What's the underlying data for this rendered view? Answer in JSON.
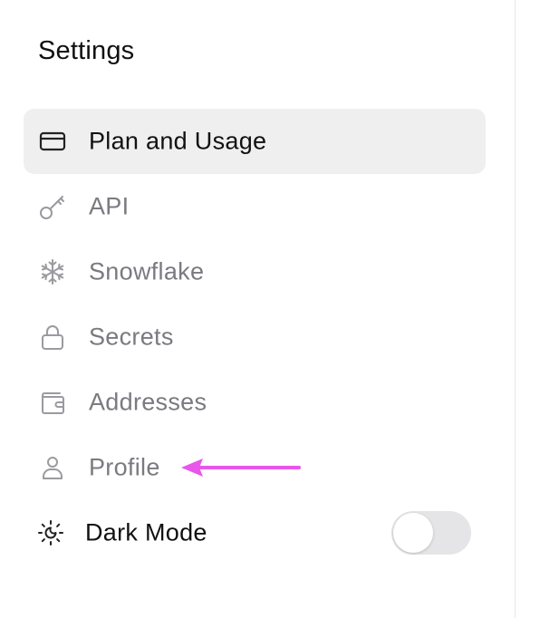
{
  "settings": {
    "title": "Settings"
  },
  "nav": {
    "items": [
      {
        "label": "Plan and Usage",
        "icon": "credit-card-icon",
        "active": true
      },
      {
        "label": "API",
        "icon": "key-icon",
        "active": false
      },
      {
        "label": "Snowflake",
        "icon": "snowflake-icon",
        "active": false
      },
      {
        "label": "Secrets",
        "icon": "lock-icon",
        "active": false
      },
      {
        "label": "Addresses",
        "icon": "wallet-icon",
        "active": false
      },
      {
        "label": "Profile",
        "icon": "user-icon",
        "active": false
      }
    ]
  },
  "dark_mode": {
    "label": "Dark Mode",
    "icon": "sun-moon-icon",
    "enabled": false
  },
  "annotation": {
    "arrow_color": "#e956e9",
    "points_to": "Profile"
  },
  "colors": {
    "active_bg": "#efeff0",
    "inactive_text": "#7a7a80",
    "active_text": "#111111",
    "icon_inactive": "#9a9aa0",
    "icon_active": "#222222",
    "toggle_off": "#e5e5e7"
  }
}
